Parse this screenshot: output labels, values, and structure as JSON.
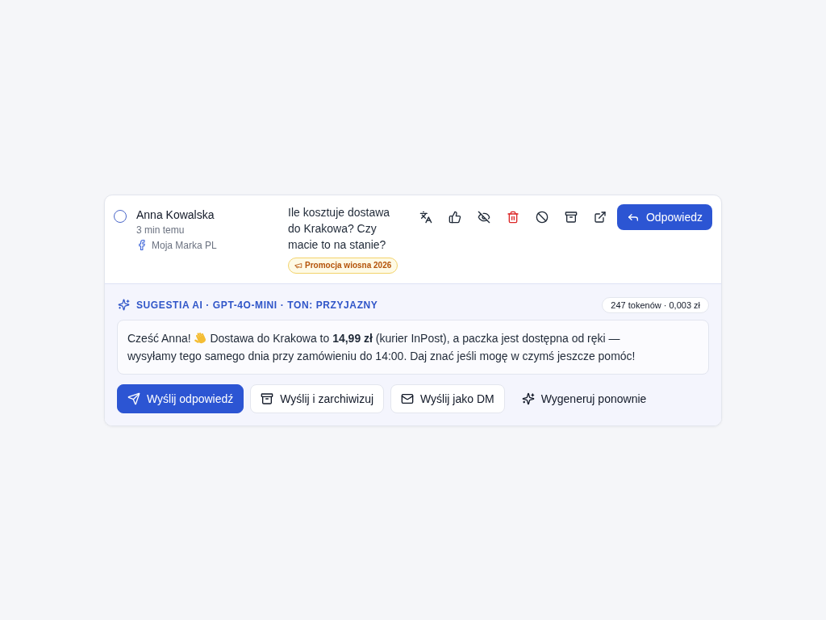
{
  "message": {
    "checked": false,
    "author": "Anna Kowalska",
    "time": "3 min temu",
    "page": "Moja Marka PL",
    "text": "Ile kosztuje dostawa do Krakowa? Czy macie to na stanie?",
    "tags": [
      "Promocja wiosna 2026"
    ],
    "reply_button": "Odpowiedz"
  },
  "ai_suggestion": {
    "header": "SUGESTIA AI · GPT-4O-MINI · TON: PRZYJAZNY",
    "usage": "247 tokenów · 0,003 zł",
    "greeting": "Cześć Anna!",
    "body": "Dostawa do Krakowa to **14,99 zł** (kurier InPost), a paczka jest dostępna od ręki — wysyłamy tego samego dnia przy zamówieniu do 14:00. Daj znać jeśli mogę w czymś jeszcze pomóc!",
    "buttons": [
      {
        "label": "Wyślij odpowiedź",
        "kind": "primary"
      },
      {
        "label": "Wyślij i zarchiwizuj",
        "kind": "outline"
      },
      {
        "label": "Wyślij jako DM",
        "kind": "outline"
      },
      {
        "label": "Wygeneruj ponownie",
        "kind": "ghost"
      }
    ]
  }
}
